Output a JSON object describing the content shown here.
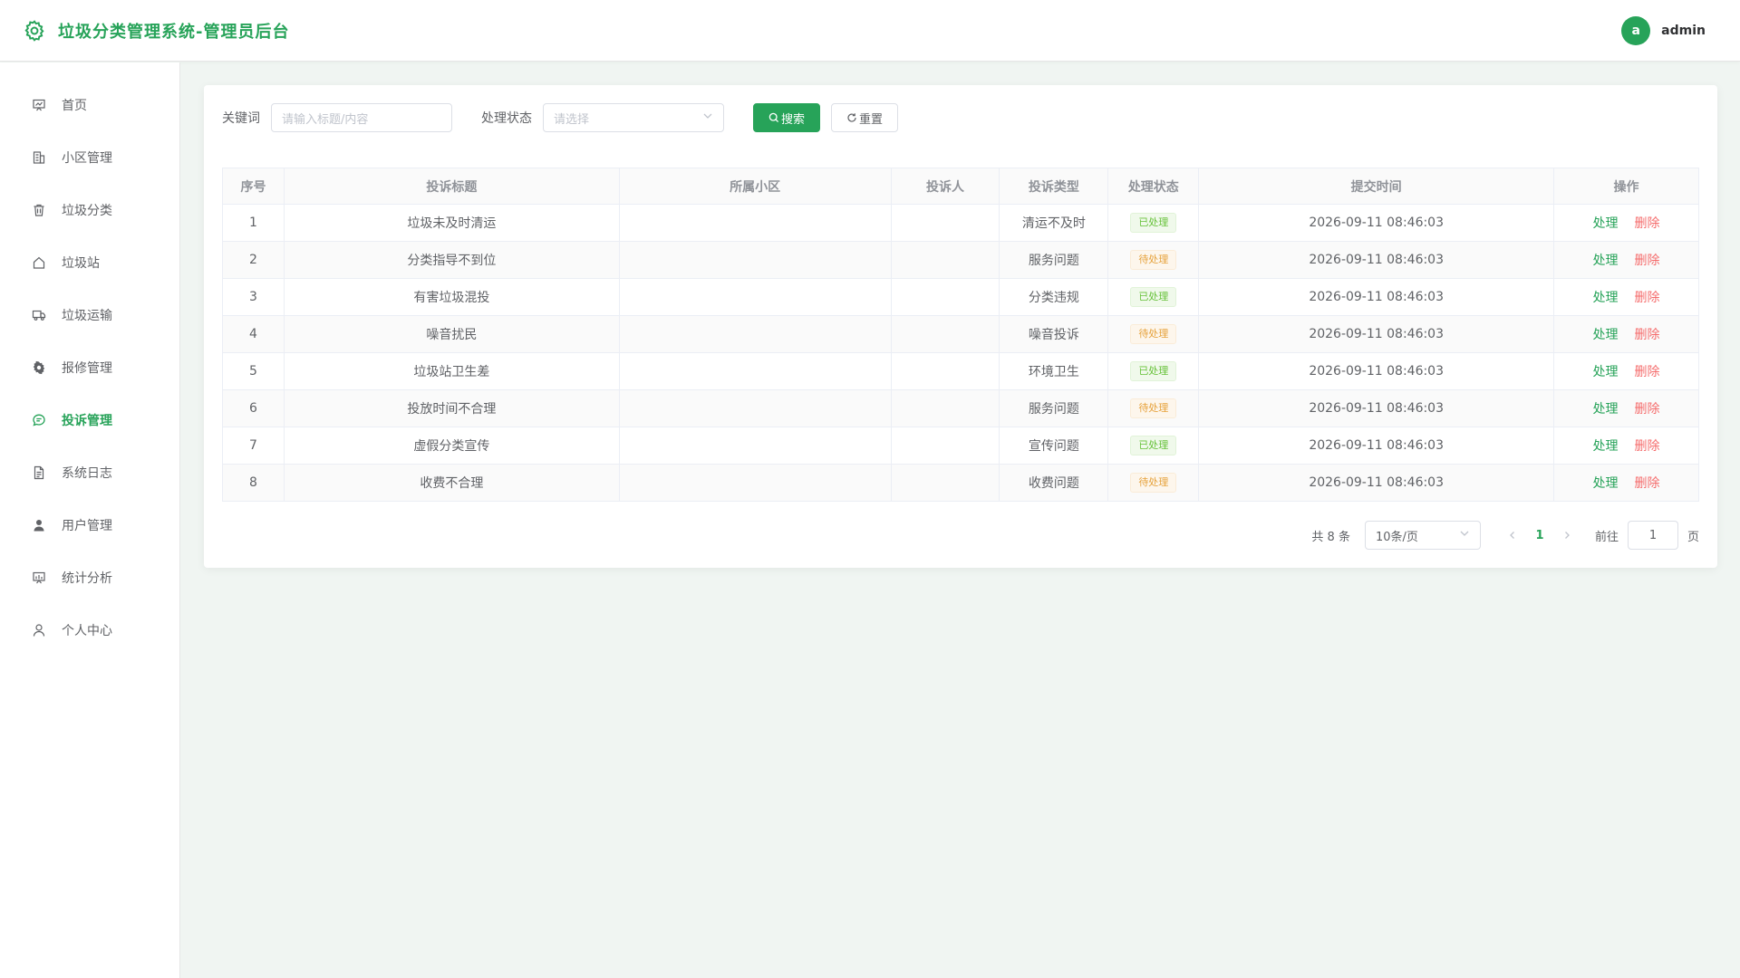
{
  "app": {
    "title": "垃圾分类管理系统-管理员后台",
    "accent_color": "#27a359"
  },
  "user": {
    "avatar_letter": "a",
    "name": "admin"
  },
  "sidebar": {
    "items": [
      {
        "label": "首页",
        "icon": "dashboard-icon",
        "active": false
      },
      {
        "label": "小区管理",
        "icon": "building-icon",
        "active": false
      },
      {
        "label": "垃圾分类",
        "icon": "trash-icon",
        "active": false
      },
      {
        "label": "垃圾站",
        "icon": "house-icon",
        "active": false
      },
      {
        "label": "垃圾运输",
        "icon": "truck-icon",
        "active": false
      },
      {
        "label": "报修管理",
        "icon": "gear-icon",
        "active": false
      },
      {
        "label": "投诉管理",
        "icon": "chat-icon",
        "active": true
      },
      {
        "label": "系统日志",
        "icon": "document-icon",
        "active": false
      },
      {
        "label": "用户管理",
        "icon": "user-filled-icon",
        "active": false
      },
      {
        "label": "统计分析",
        "icon": "chart-board-icon",
        "active": false
      },
      {
        "label": "个人中心",
        "icon": "user-outline-icon",
        "active": false
      }
    ]
  },
  "filters": {
    "keyword_label": "关键词",
    "keyword_placeholder": "请输入标题/内容",
    "status_label": "处理状态",
    "status_placeholder": "请选择",
    "search_label": "搜索",
    "reset_label": "重置"
  },
  "table": {
    "headers": [
      "序号",
      "投诉标题",
      "所属小区",
      "投诉人",
      "投诉类型",
      "处理状态",
      "提交时间",
      "操作"
    ],
    "rows": [
      {
        "no": "1",
        "title": "垃圾未及时清运",
        "community": "",
        "complainant": "",
        "type": "清运不及时",
        "status": "已处理",
        "status_kind": "success",
        "time": "2026-09-11 08:46:03"
      },
      {
        "no": "2",
        "title": "分类指导不到位",
        "community": "",
        "complainant": "",
        "type": "服务问题",
        "status": "待处理",
        "status_kind": "warning",
        "time": "2026-09-11 08:46:03"
      },
      {
        "no": "3",
        "title": "有害垃圾混投",
        "community": "",
        "complainant": "",
        "type": "分类违规",
        "status": "已处理",
        "status_kind": "success",
        "time": "2026-09-11 08:46:03"
      },
      {
        "no": "4",
        "title": "噪音扰民",
        "community": "",
        "complainant": "",
        "type": "噪音投诉",
        "status": "待处理",
        "status_kind": "warning",
        "time": "2026-09-11 08:46:03"
      },
      {
        "no": "5",
        "title": "垃圾站卫生差",
        "community": "",
        "complainant": "",
        "type": "环境卫生",
        "status": "已处理",
        "status_kind": "success",
        "time": "2026-09-11 08:46:03"
      },
      {
        "no": "6",
        "title": "投放时间不合理",
        "community": "",
        "complainant": "",
        "type": "服务问题",
        "status": "待处理",
        "status_kind": "warning",
        "time": "2026-09-11 08:46:03"
      },
      {
        "no": "7",
        "title": "虚假分类宣传",
        "community": "",
        "complainant": "",
        "type": "宣传问题",
        "status": "已处理",
        "status_kind": "success",
        "time": "2026-09-11 08:46:03"
      },
      {
        "no": "8",
        "title": "收费不合理",
        "community": "",
        "complainant": "",
        "type": "收费问题",
        "status": "待处理",
        "status_kind": "warning",
        "time": "2026-09-11 08:46:03"
      }
    ],
    "action_edit": "处理",
    "action_delete": "删除"
  },
  "pagination": {
    "total_text": "共 8 条",
    "page_size": "10条/页",
    "current_page": "1",
    "goto_label": "前往",
    "goto_value": "1",
    "goto_suffix": "页"
  }
}
